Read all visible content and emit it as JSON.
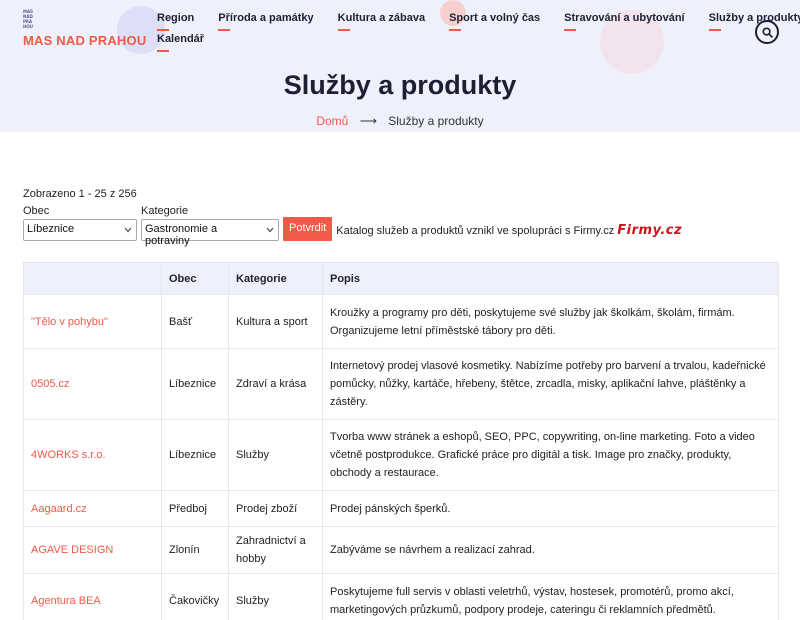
{
  "header": {
    "logo_mark": [
      "MAS",
      "NAD",
      "PRA",
      "HOU"
    ],
    "logo_text": "MAS NAD PRAHOU",
    "nav": [
      {
        "label": "Region"
      },
      {
        "label": "Příroda a památky"
      },
      {
        "label": "Kultura a zábava"
      },
      {
        "label": "Sport a volný čas"
      },
      {
        "label": "Stravování a ubytování"
      },
      {
        "label": "Služby a produkty"
      },
      {
        "label": "Kalendář"
      }
    ],
    "search_icon": "search-icon"
  },
  "page": {
    "title": "Služby a produkty",
    "breadcrumb": {
      "home": "Domů",
      "separator": "⟶",
      "current": "Služby a produkty"
    }
  },
  "results": {
    "count_text": "Zobrazeno 1 - 25 z 256"
  },
  "filters": {
    "obec": {
      "label": "Obec",
      "value": "Líbeznice"
    },
    "kategorie": {
      "label": "Kategorie",
      "value": "Gastronomie a potraviny"
    },
    "submit_label": "Potvrdit",
    "note": "Katalog služeb a produktů vznikl ve spolupráci s Firmy.cz",
    "firmy_logo": "Firmy.cz"
  },
  "table": {
    "headers": [
      "",
      "Obec",
      "Kategorie",
      "Popis"
    ],
    "rows": [
      {
        "name": "\"Tělo v pohybu\"",
        "obec": "Bašť",
        "kategorie": "Kultura a sport",
        "popis": "Kroužky a programy pro děti, poskytujeme své služby jak školkám, školám, firmám. Organizujeme letní příměstské tábory pro děti."
      },
      {
        "name": "0505.cz",
        "obec": "Líbeznice",
        "kategorie": "Zdraví a krása",
        "popis": "Internetový prodej vlasové kosmetiky. Nabízíme potřeby pro barvení a trvalou, kadeřnické pomůcky, nůžky, kartáče, hřebeny, štětce, zrcadla, misky, aplikační lahve, pláštěnky a zástěry."
      },
      {
        "name": "4WORKS s.r.o.",
        "obec": "Líbeznice",
        "kategorie": "Služby",
        "popis": "Tvorba www stránek a eshopů, SEO, PPC, copywriting, on-line marketing. Foto a video včetně postprodukce. Grafické práce pro digitál a tisk. Image pro značky, produkty, obchody a restaurace."
      },
      {
        "name": "Aagaard.cz",
        "obec": "Předboj",
        "kategorie": "Prodej zboží",
        "popis": "Prodej pánských šperků."
      },
      {
        "name": "AGAVE DESIGN",
        "obec": "Zlonín",
        "kategorie": "Zahradnictví a hobby",
        "popis": "Zabýváme se návrhem a realizací zahrad."
      },
      {
        "name": "Agentura BEA",
        "obec": "Čakovičky",
        "kategorie": "Služby",
        "popis": "Poskytujeme full servis v oblasti veletrhů, výstav, hostesek, promotérů, promo akcí, marketingových průzkumů, podpory prodeje, cateringu či reklamních předmětů."
      }
    ]
  },
  "colors": {
    "accent": "#f05a47",
    "hero_bg": "#eef0fb",
    "nav_text": "#1d2033",
    "firmy_red": "#c8151b"
  }
}
